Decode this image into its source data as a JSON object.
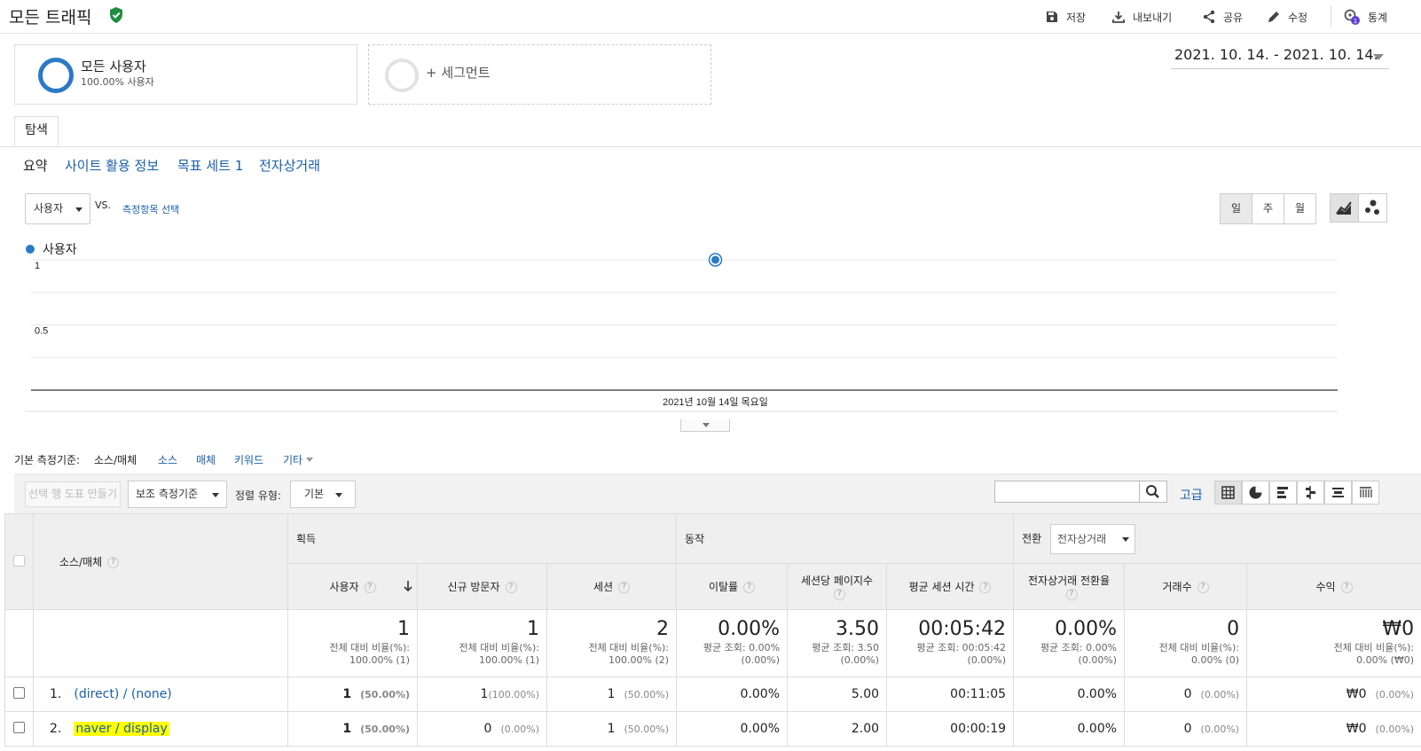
{
  "header": {
    "title": "모든 트래픽",
    "actions": {
      "save": "저장",
      "export": "내보내기",
      "share": "공유",
      "edit": "수정",
      "insights": "통계",
      "insights_badge": "1"
    }
  },
  "segments": {
    "primary_title": "모든 사용자",
    "primary_sub": "100.00% 사용자",
    "add_label": "+ 세그먼트"
  },
  "date_range": "2021. 10. 14. - 2021. 10. 14.",
  "tabs": {
    "explore": "탐색",
    "sub": [
      "요약",
      "사이트 활용 정보",
      "목표 세트 1",
      "전자상거래"
    ]
  },
  "chart_controls": {
    "metric": "사용자",
    "vs": "VS.",
    "compare_placeholder": "측정항목 선택",
    "periods": [
      "일",
      "주",
      "월"
    ]
  },
  "chart_data": {
    "type": "line",
    "series": [
      {
        "name": "사용자",
        "x": [
          "2021년 10월 14일 목요일"
        ],
        "values": [
          1
        ]
      }
    ],
    "y_ticks": [
      "1",
      "0.5"
    ],
    "ylim": [
      0,
      1
    ],
    "x_label": "2021년 10월 14일 목요일",
    "color": "#2a7ac6",
    "grid": true
  },
  "dimension_bar": {
    "label": "기본 측정기준:",
    "selected": "소스/매체",
    "options": [
      "소스",
      "매체",
      "키워드",
      "기타"
    ]
  },
  "table_toolbar": {
    "plot_rows": "선택 행 도표 만들기",
    "secondary_dim": "보조 측정기준",
    "sort_label": "정렬 유형:",
    "sort_value": "기본",
    "advanced": "고급"
  },
  "table": {
    "dim_header": "소스/매체",
    "groups": {
      "acquisition": "획득",
      "behavior": "동작",
      "conversion": "전환",
      "conversion_select": "전자상거래"
    },
    "columns": [
      "사용자",
      "신규 방문자",
      "세션",
      "이탈률",
      "세션당 페이지수",
      "평균 세션 시간",
      "전자상거래 전환율",
      "거래수",
      "수익"
    ],
    "totals": [
      {
        "value": "1",
        "sub1": "전체 대비 비율(%):",
        "sub2": "100.00% (1)"
      },
      {
        "value": "1",
        "sub1": "전체 대비 비율(%):",
        "sub2": "100.00% (1)"
      },
      {
        "value": "2",
        "sub1": "전체 대비 비율(%):",
        "sub2": "100.00% (2)"
      },
      {
        "value": "0.00%",
        "sub1": "평균 조회: 0.00%",
        "sub2": "(0.00%)"
      },
      {
        "value": "3.50",
        "sub1": "평균 조회: 3.50",
        "sub2": "(0.00%)"
      },
      {
        "value": "00:05:42",
        "sub1": "평균 조회: 00:05:42",
        "sub2": "(0.00%)"
      },
      {
        "value": "0.00%",
        "sub1": "평균 조회: 0.00%",
        "sub2": "(0.00%)"
      },
      {
        "value": "0",
        "sub1": "전체 대비 비율(%):",
        "sub2": "0.00% (0)"
      },
      {
        "value": "₩0",
        "sub1": "전체 대비 비율(%):",
        "sub2": "0.00% (₩0)"
      }
    ],
    "rows": [
      {
        "index": "1.",
        "dim": "(direct) / (none)",
        "users": "1",
        "users_pct": "(50.00%)",
        "new_users": "1",
        "new_users_pct": "(100.00%)",
        "sessions": "1",
        "sessions_pct": "(50.00%)",
        "bounce": "0.00%",
        "pages": "5.00",
        "duration": "00:11:05",
        "conv_rate": "0.00%",
        "transactions": "0",
        "transactions_pct": "(0.00%)",
        "revenue": "₩0",
        "revenue_pct": "(0.00%)"
      },
      {
        "index": "2.",
        "dim": "naver / display",
        "users": "1",
        "users_pct": "(50.00%)",
        "new_users": "0",
        "new_users_pct": "(0.00%)",
        "sessions": "1",
        "sessions_pct": "(50.00%)",
        "bounce": "0.00%",
        "pages": "2.00",
        "duration": "00:00:19",
        "conv_rate": "0.00%",
        "transactions": "0",
        "transactions_pct": "(0.00%)",
        "revenue": "₩0",
        "revenue_pct": "(0.00%)"
      }
    ]
  }
}
